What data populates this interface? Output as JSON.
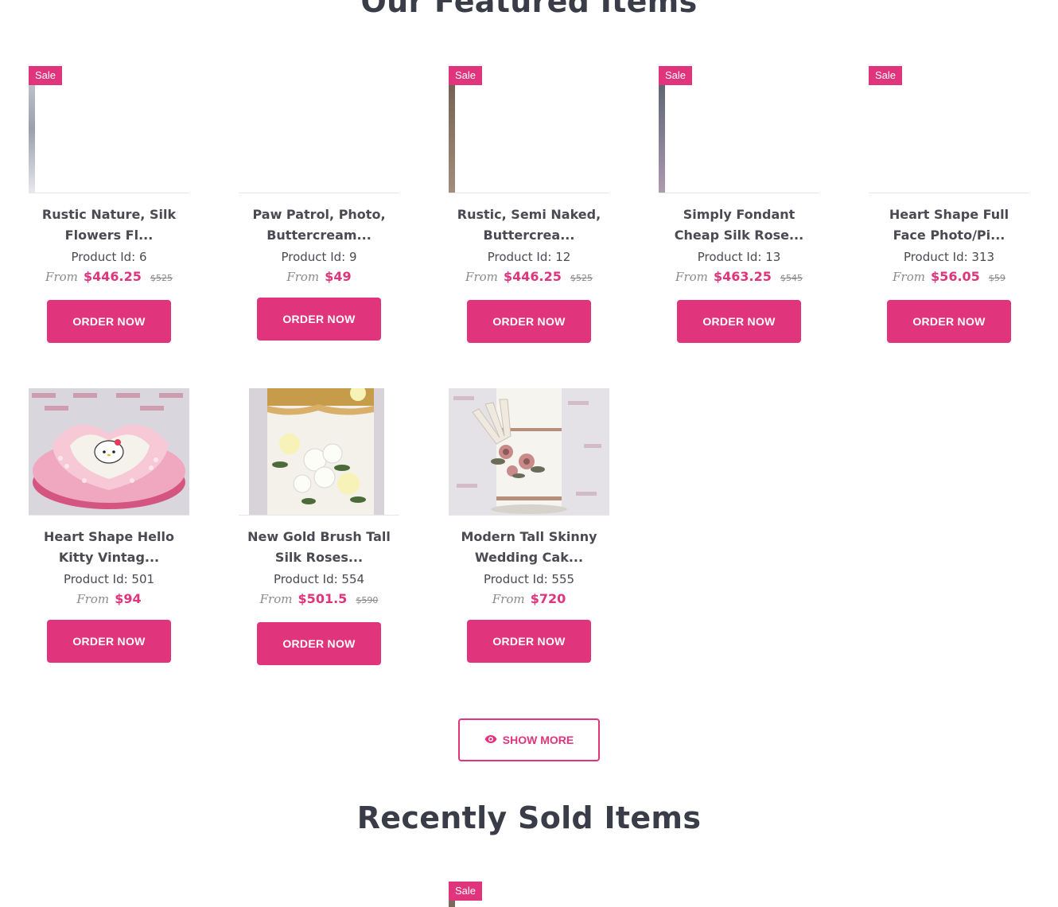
{
  "featured_title": "Our Featured Items",
  "recent_title": "Recently Sold Items",
  "order_label": "ORDER NOW",
  "show_more_label": "SHOW MORE",
  "sale_label": "Sale",
  "from_label": "From",
  "accent_color": "#e0347c",
  "products": [
    {
      "name": "Rustic Nature, Silk Flowers Fl...",
      "id_text": "Product Id: 6",
      "price": "$446.25",
      "old_price": "$525",
      "sale": true,
      "image": "broken"
    },
    {
      "name": "Paw Patrol, Photo, Buttercream...",
      "id_text": "Product Id: 9",
      "price": "$49",
      "old_price": "",
      "sale": false,
      "image": "broken"
    },
    {
      "name": "Rustic, Semi Naked, Buttercrea...",
      "id_text": "Product Id: 12",
      "price": "$446.25",
      "old_price": "$525",
      "sale": true,
      "image": "broken"
    },
    {
      "name": "Simply Fondant Cheap Silk Rose...",
      "id_text": "Product Id: 13",
      "price": "$463.25",
      "old_price": "$545",
      "sale": true,
      "image": "broken"
    },
    {
      "name": "Heart Shape Full Face Photo/Pi...",
      "id_text": "Product Id: 313",
      "price": "$56.05",
      "old_price": "$59",
      "sale": true,
      "image": "broken"
    },
    {
      "name": "Heart Shape Hello Kitty Vintag...",
      "id_text": "Product Id: 501",
      "price": "$94",
      "old_price": "",
      "sale": false,
      "image": "hello-kitty-heart-cake"
    },
    {
      "name": "New Gold Brush Tall Silk Roses...",
      "id_text": "Product Id: 554",
      "price": "$501.5",
      "old_price": "$590",
      "sale": false,
      "image": "gold-brush-roses-cake"
    },
    {
      "name": "Modern Tall Skinny Wedding Cak...",
      "id_text": "Product Id: 555",
      "price": "$720",
      "old_price": "",
      "sale": false,
      "image": "tall-wedding-cake"
    }
  ]
}
